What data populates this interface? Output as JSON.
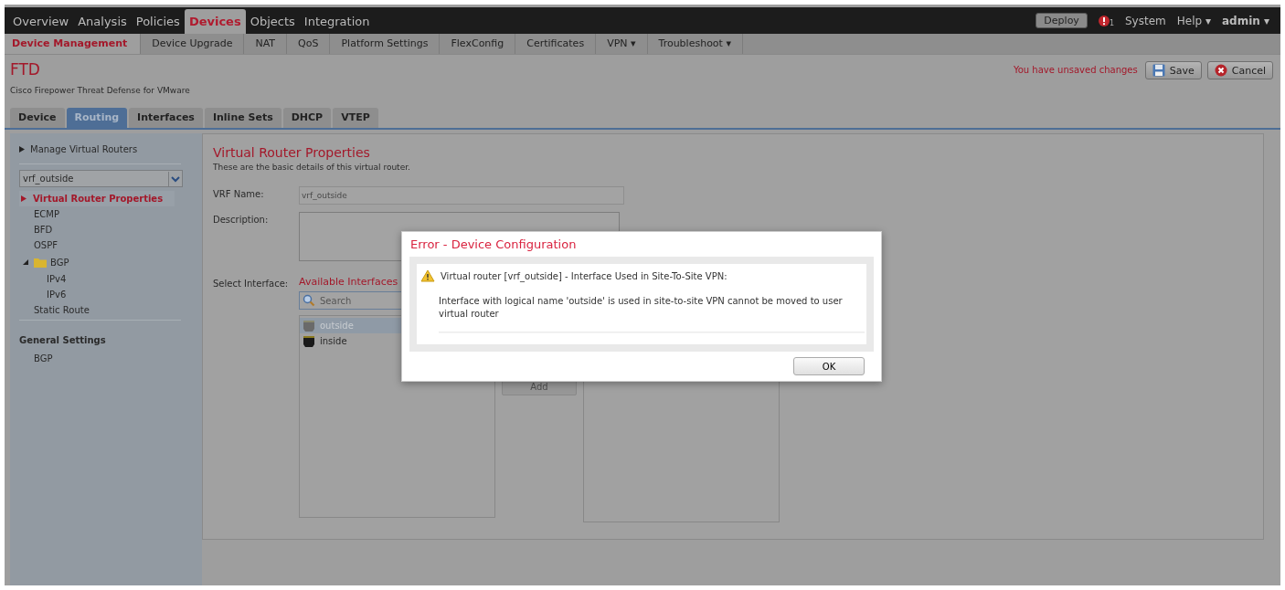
{
  "top_nav": {
    "items": [
      {
        "label": "Overview",
        "selected": false
      },
      {
        "label": "Analysis",
        "selected": false
      },
      {
        "label": "Policies",
        "selected": false
      },
      {
        "label": "Devices",
        "selected": true
      },
      {
        "label": "Objects",
        "selected": false
      },
      {
        "label": "Integration",
        "selected": false
      }
    ],
    "deploy": "Deploy",
    "alert_count": "1",
    "system": "System",
    "help": "Help ▾",
    "user": "admin ▾"
  },
  "sub_nav": [
    {
      "label": "Device Management",
      "selected": true
    },
    {
      "label": "Device Upgrade",
      "selected": false
    },
    {
      "label": "NAT",
      "selected": false
    },
    {
      "label": "QoS",
      "selected": false
    },
    {
      "label": "Platform Settings",
      "selected": false
    },
    {
      "label": "FlexConfig",
      "selected": false
    },
    {
      "label": "Certificates",
      "selected": false
    },
    {
      "label": "VPN ▾",
      "selected": false
    },
    {
      "label": "Troubleshoot ▾",
      "selected": false
    }
  ],
  "device": {
    "name": "FTD",
    "model": "Cisco Firepower Threat Defense for VMware",
    "unsaved": "You have unsaved changes",
    "save": "Save",
    "cancel": "Cancel"
  },
  "device_tabs": [
    {
      "label": "Device",
      "selected": false
    },
    {
      "label": "Routing",
      "selected": true
    },
    {
      "label": "Interfaces",
      "selected": false
    },
    {
      "label": "Inline Sets",
      "selected": false
    },
    {
      "label": "DHCP",
      "selected": false
    },
    {
      "label": "VTEP",
      "selected": false
    }
  ],
  "sidebar": {
    "manage": {
      "label": "Manage Virtual Routers",
      "expanded": false
    },
    "router_select": "vrf_outside",
    "items": [
      {
        "label": "Virtual Router Properties",
        "selected": true
      },
      {
        "label": "ECMP",
        "selected": false
      },
      {
        "label": "BFD",
        "selected": false
      },
      {
        "label": "OSPF",
        "selected": false
      },
      {
        "label": "BGP",
        "selected": false,
        "expanded": true,
        "children": [
          {
            "label": "IPv4",
            "selected": false
          },
          {
            "label": "IPv6",
            "selected": false
          }
        ]
      },
      {
        "label": "Static Route",
        "selected": false
      }
    ],
    "general_heading": "General Settings",
    "general_items": [
      {
        "label": "BGP",
        "selected": false
      }
    ]
  },
  "content": {
    "title": "Virtual Router Properties",
    "subtitle": "These are the basic details of this virtual router.",
    "vrf_label": "VRF Name:",
    "vrf_value": "vrf_outside",
    "description_label": "Description:",
    "select_label": "Select Interface:",
    "available_heading": "Available Interfaces",
    "search_placeholder": "Search",
    "interfaces": [
      {
        "label": "outside",
        "selected": true,
        "disabled": true
      },
      {
        "label": "inside",
        "selected": false,
        "disabled": false
      }
    ],
    "add": "Add"
  },
  "dialog": {
    "title": "Error - Device Configuration",
    "heading": "Virtual router [vrf_outside] -  Interface Used in Site-To-Site VPN:",
    "message": "Interface with logical name 'outside' is used in site-to-site VPN cannot be moved to user virtual router",
    "ok": "OK"
  }
}
